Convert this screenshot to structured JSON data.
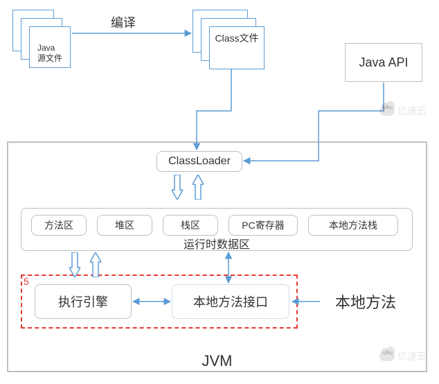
{
  "chart_data": {
    "type": "diagram",
    "title": "Java 编译运行流程 / JVM 架构",
    "nodes": [
      {
        "id": "java_source",
        "label": "Java\n源文件"
      },
      {
        "id": "class_file",
        "label": "Class文件"
      },
      {
        "id": "java_api",
        "label": "Java API"
      },
      {
        "id": "classloader",
        "label": "ClassLoader"
      },
      {
        "id": "method_area",
        "label": "方法区"
      },
      {
        "id": "heap",
        "label": "堆区"
      },
      {
        "id": "stack",
        "label": "栈区"
      },
      {
        "id": "pc_register",
        "label": "PC寄存器"
      },
      {
        "id": "native_stack",
        "label": "本地方法栈"
      },
      {
        "id": "runtime_area",
        "label": "运行时数据区"
      },
      {
        "id": "exec_engine",
        "label": "执行引擎"
      },
      {
        "id": "native_iface",
        "label": "本地方法接口"
      },
      {
        "id": "native_method",
        "label": "本地方法"
      },
      {
        "id": "jvm_container",
        "label": "JVM"
      }
    ],
    "edges": [
      {
        "from": "java_source",
        "to": "class_file",
        "label": "编译",
        "dir": "single"
      },
      {
        "from": "class_file",
        "to": "classloader",
        "dir": "single"
      },
      {
        "from": "java_api",
        "to": "classloader",
        "dir": "single"
      },
      {
        "from": "classloader",
        "to": "runtime_area",
        "dir": "both",
        "style": "hollow"
      },
      {
        "from": "runtime_area",
        "to": "exec_engine",
        "dir": "both",
        "style": "hollow"
      },
      {
        "from": "runtime_area",
        "to": "native_iface",
        "dir": "both"
      },
      {
        "from": "exec_engine",
        "to": "native_iface",
        "dir": "both"
      },
      {
        "from": "native_method",
        "to": "native_iface",
        "dir": "single"
      }
    ],
    "highlight_group": {
      "id": "5",
      "members": [
        "exec_engine",
        "native_iface"
      ]
    }
  },
  "compile_label": "编译",
  "java_source_label": "Java\n源文件",
  "class_file_label": "Class文件",
  "java_api_label": "Java API",
  "classloader_label": "ClassLoader",
  "method_area_label": "方法区",
  "heap_label": "堆区",
  "stack_label": "栈区",
  "pc_register_label": "PC寄存器",
  "native_stack_label": "本地方法栈",
  "runtime_area_label": "运行时数据区",
  "exec_engine_label": "执行引擎",
  "native_iface_label": "本地方法接口",
  "native_method_label": "本地方法",
  "jvm_label": "JVM",
  "highlight_num": "5",
  "watermark_text": "亿速云",
  "colors": {
    "line_blue": "#5b9bd5",
    "box_gray": "#bfbfbf",
    "highlight_red": "#e53935"
  }
}
